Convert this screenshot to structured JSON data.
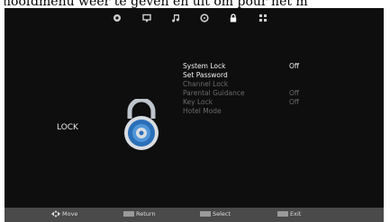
{
  "caption_top": "hoofdmenu weer te geven en      uit om       pour het m",
  "tabs": [
    {
      "name": "picture-tab",
      "icon": "picture-icon"
    },
    {
      "name": "screen-tab",
      "icon": "screen-icon"
    },
    {
      "name": "sound-tab",
      "icon": "music-note-icon"
    },
    {
      "name": "timer-tab",
      "icon": "clock-icon"
    },
    {
      "name": "lock-tab",
      "icon": "lock-icon",
      "active": true
    },
    {
      "name": "setup-tab",
      "icon": "grid-icon"
    }
  ],
  "section_title": "LOCK",
  "menu": [
    {
      "label": "System Lock",
      "value": "Off",
      "enabled": true
    },
    {
      "label": "Set Password",
      "value": "",
      "enabled": true
    },
    {
      "label": "Channel Lock",
      "value": "",
      "enabled": false
    },
    {
      "label": "Parental Guidance",
      "value": "Off",
      "enabled": false
    },
    {
      "label": "Key Lock",
      "value": "Off",
      "enabled": false
    },
    {
      "label": "Hotel Mode",
      "value": "",
      "enabled": false
    }
  ],
  "footer": {
    "move": "Move",
    "return": "Return",
    "select": "Select",
    "exit": "Exit"
  },
  "colors": {
    "background": "#0e0e0e",
    "footer": "#4a4a4a",
    "text_enabled": "#f2f2f2",
    "text_disabled": "#6a6a6a",
    "lock_blue": "#2a6fb8"
  }
}
